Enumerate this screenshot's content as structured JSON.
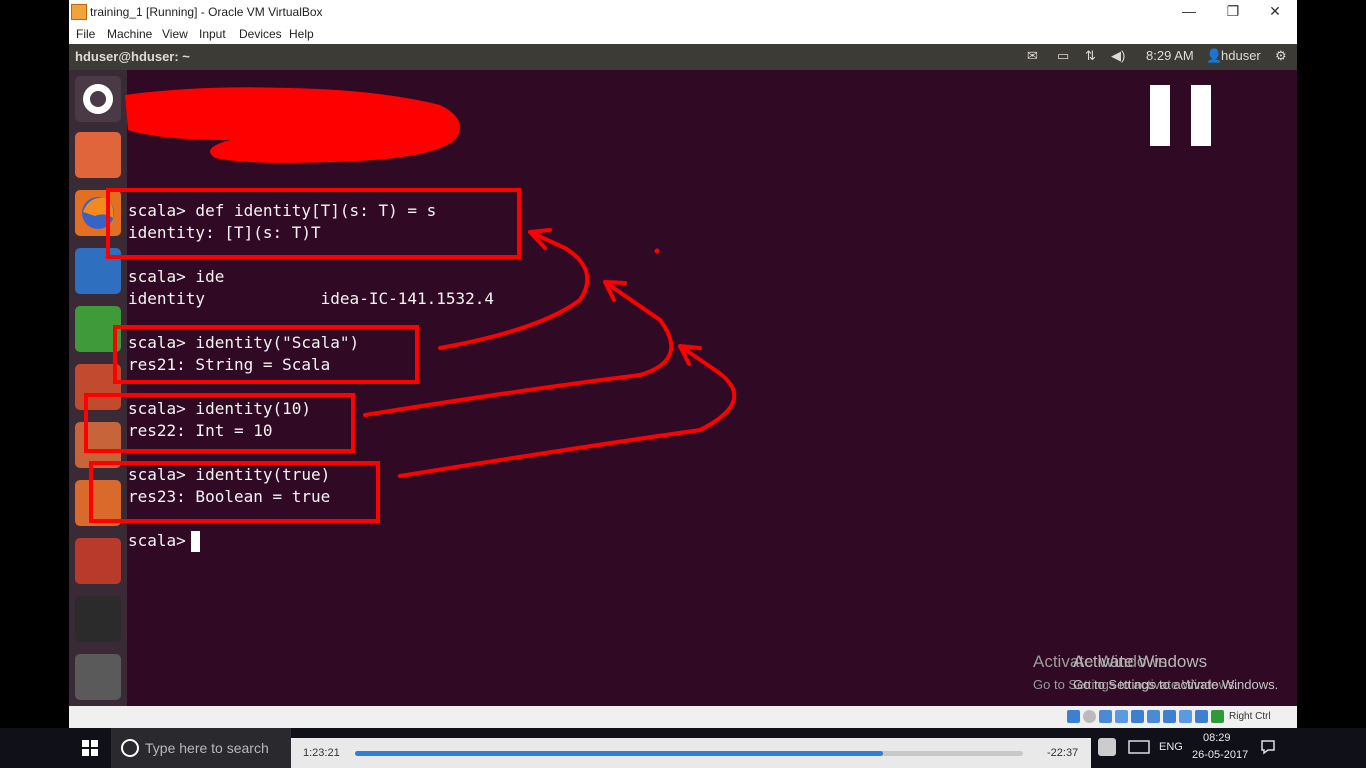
{
  "window": {
    "title": "training_1 [Running] - Oracle VM VirtualBox",
    "minimize_glyph": "—",
    "maximize_glyph": "❐",
    "close_glyph": "✕"
  },
  "menubar": [
    "File",
    "Machine",
    "View",
    "Input",
    "Devices",
    "Help"
  ],
  "ubuntu_topbar": {
    "window_title": "hduser@hduser: ~",
    "time": "8:29 AM",
    "user": "hduser"
  },
  "terminal": {
    "lines": [
      "scala> def identity[T](s: T) = s",
      "identity: [T](s: T)T",
      "scala> ide",
      "identity            idea-IC-141.1532.4",
      "scala> identity(\"Scala\")",
      "res21: String = Scala",
      "scala> identity(10)",
      "res22: Int = 10",
      "scala> identity(true)",
      "res23: Boolean = true",
      "scala> "
    ]
  },
  "watermark": {
    "line1": "Activate Windows",
    "line2": "Go to Settings to activate Windows."
  },
  "statusbar": {
    "host_key": "Right Ctrl"
  },
  "taskbar": {
    "search_placeholder": "Type here to search",
    "language": "ENG",
    "time": "08:29",
    "date": "26-05-2017"
  },
  "player": {
    "elapsed": "1:23:21",
    "remaining": "-22:37",
    "progress": 0.79
  },
  "colors": {
    "terminal_bg": "#300a24",
    "annotation_red": "#ff0000",
    "ubuntu_panel": "#3d3b36",
    "launcher": "#3a2a35"
  }
}
